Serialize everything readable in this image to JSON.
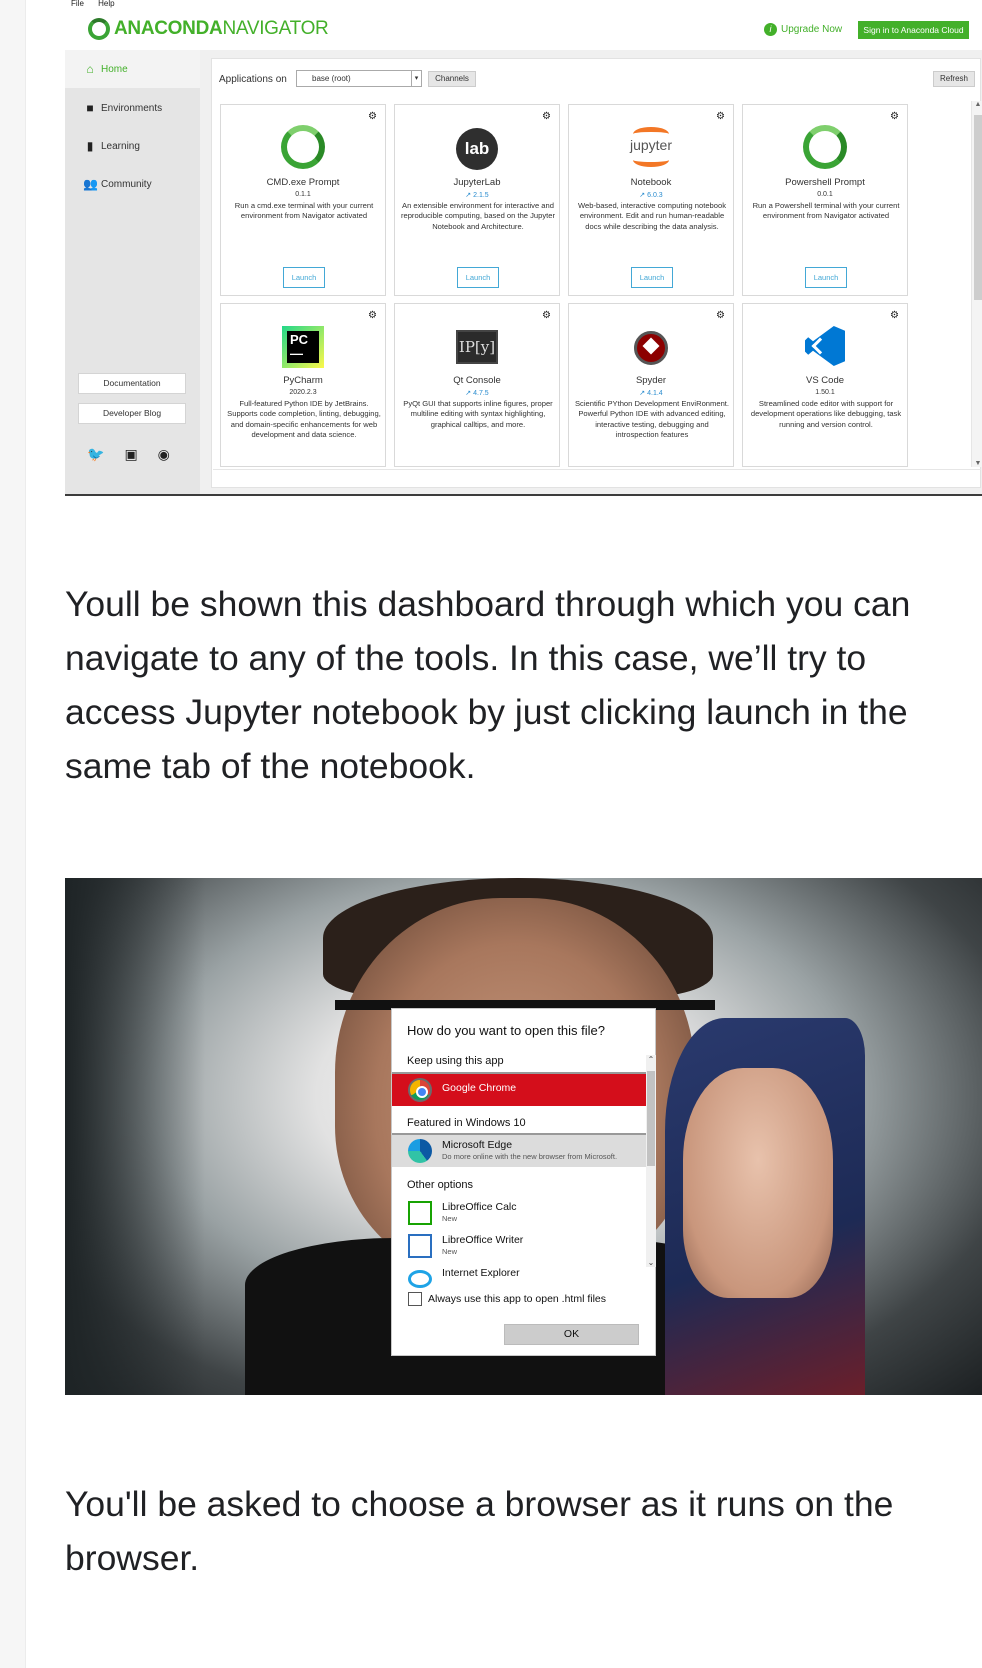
{
  "navigator": {
    "menu": [
      "File",
      "Help"
    ],
    "brand_bold": "ANACONDA",
    "brand_light": "NAVIGATOR",
    "upgrade_label": "Upgrade Now",
    "signin_label": "Sign in to Anaconda Cloud",
    "sidebar": {
      "items": [
        {
          "label": "Home",
          "icon": "home-icon"
        },
        {
          "label": "Environments",
          "icon": "cube-icon"
        },
        {
          "label": "Learning",
          "icon": "book-icon"
        },
        {
          "label": "Community",
          "icon": "people-icon"
        }
      ],
      "documentation_label": "Documentation",
      "blog_label": "Developer Blog",
      "social_icons": [
        "twitter-icon",
        "youtube-icon",
        "github-icon"
      ]
    },
    "toolbar": {
      "applications_on_label": "Applications on",
      "environment_value": "base (root)",
      "channels_label": "Channels",
      "refresh_label": "Refresh"
    },
    "apps": [
      {
        "name": "CMD.exe Prompt",
        "version": "0.1.1",
        "desc": "Run a cmd.exe terminal with your current environment from Navigator activated",
        "launch": "Launch"
      },
      {
        "name": "JupyterLab",
        "version": "↗ 2.1.5",
        "desc": "An extensible environment for interactive and reproducible computing, based on the Jupyter Notebook and Architecture.",
        "launch": "Launch"
      },
      {
        "name": "Notebook",
        "version": "↗ 6.0.3",
        "desc": "Web-based, interactive computing notebook environment. Edit and run human-readable docs while describing the data analysis.",
        "launch": "Launch"
      },
      {
        "name": "Powershell Prompt",
        "version": "0.0.1",
        "desc": "Run a Powershell terminal with your current environment from Navigator activated",
        "launch": "Launch"
      },
      {
        "name": "PyCharm",
        "version": "2020.2.3",
        "desc": "Full-featured Python IDE by JetBrains. Supports code completion, linting, debugging, and domain-specific enhancements for web development and data science."
      },
      {
        "name": "Qt Console",
        "version": "↗ 4.7.5",
        "desc": "PyQt GUI that supports inline figures, proper multiline editing with syntax highlighting, graphical calltips, and more."
      },
      {
        "name": "Spyder",
        "version": "↗ 4.1.4",
        "desc": "Scientific PYthon Development EnviRonment. Powerful Python IDE with advanced editing, interactive testing, debugging and introspection features"
      },
      {
        "name": "VS Code",
        "version": "1.50.1",
        "desc": "Streamlined code editor with support for development operations like debugging, task running and version control."
      }
    ]
  },
  "article": {
    "para1": [
      "Youll be shown this dashboard through which you can",
      "navigate to any of the tools. In this case, we’ll try to",
      "access Jupyter notebook by just clicking launch in the",
      "same tab of the notebook."
    ],
    "para2": [
      "You'll be asked to choose a browser as it runs on the",
      "browser."
    ]
  },
  "dialog": {
    "title": "How do you want to open this file?",
    "keep_label": "Keep using this app",
    "selected_app": "Google Chrome",
    "featured_label": "Featured in Windows 10",
    "edge_name": "Microsoft Edge",
    "edge_sub": "Do more online with the new browser from Microsoft.",
    "other_label": "Other options",
    "calc_name": "LibreOffice Calc",
    "calc_sub": "New",
    "writer_name": "LibreOffice Writer",
    "writer_sub": "New",
    "ie_name": "Internet Explorer",
    "always_label": "Always use this app to open .html files",
    "ok_label": "OK"
  }
}
